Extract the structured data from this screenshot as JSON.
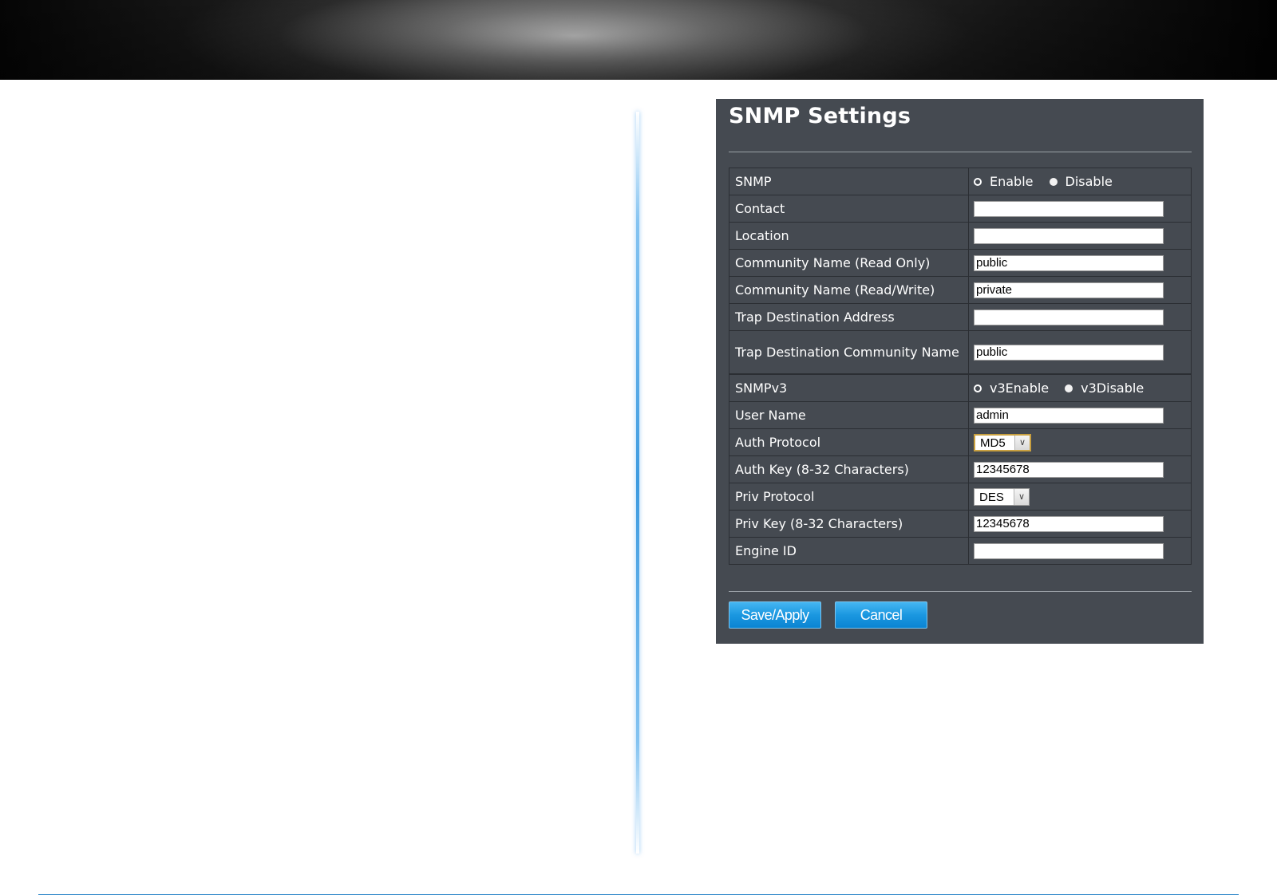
{
  "panel": {
    "title": "SNMP Settings"
  },
  "fields": {
    "snmp": {
      "label": "SNMP",
      "enable_label": "Enable",
      "disable_label": "Disable",
      "selected": "Enable"
    },
    "contact": {
      "label": "Contact",
      "value": ""
    },
    "location": {
      "label": "Location",
      "value": ""
    },
    "community_ro": {
      "label": "Community Name (Read Only)",
      "value": "public"
    },
    "community_rw": {
      "label": "Community Name (Read/Write)",
      "value": "private"
    },
    "trap_address": {
      "label": "Trap Destination Address",
      "value": ""
    },
    "trap_community": {
      "label": "Trap Destination Community Name",
      "value": "public"
    },
    "snmpv3": {
      "label": "SNMPv3",
      "enable_label": "v3Enable",
      "disable_label": "v3Disable",
      "selected": "v3Enable"
    },
    "user_name": {
      "label": "User Name",
      "value": "admin"
    },
    "auth_protocol": {
      "label": "Auth Protocol",
      "value": "MD5"
    },
    "auth_key": {
      "label": "Auth Key (8-32 Characters)",
      "value": "12345678"
    },
    "priv_protocol": {
      "label": "Priv Protocol",
      "value": "DES"
    },
    "priv_key": {
      "label": "Priv Key (8-32 Characters)",
      "value": "12345678"
    },
    "engine_id": {
      "label": "Engine ID",
      "value": ""
    }
  },
  "buttons": {
    "save_label": "Save/Apply",
    "cancel_label": "Cancel"
  },
  "colors": {
    "panel_bg": "#454a51",
    "button_blue": "#1b97e0",
    "divider_blue": "#3d9be0"
  }
}
